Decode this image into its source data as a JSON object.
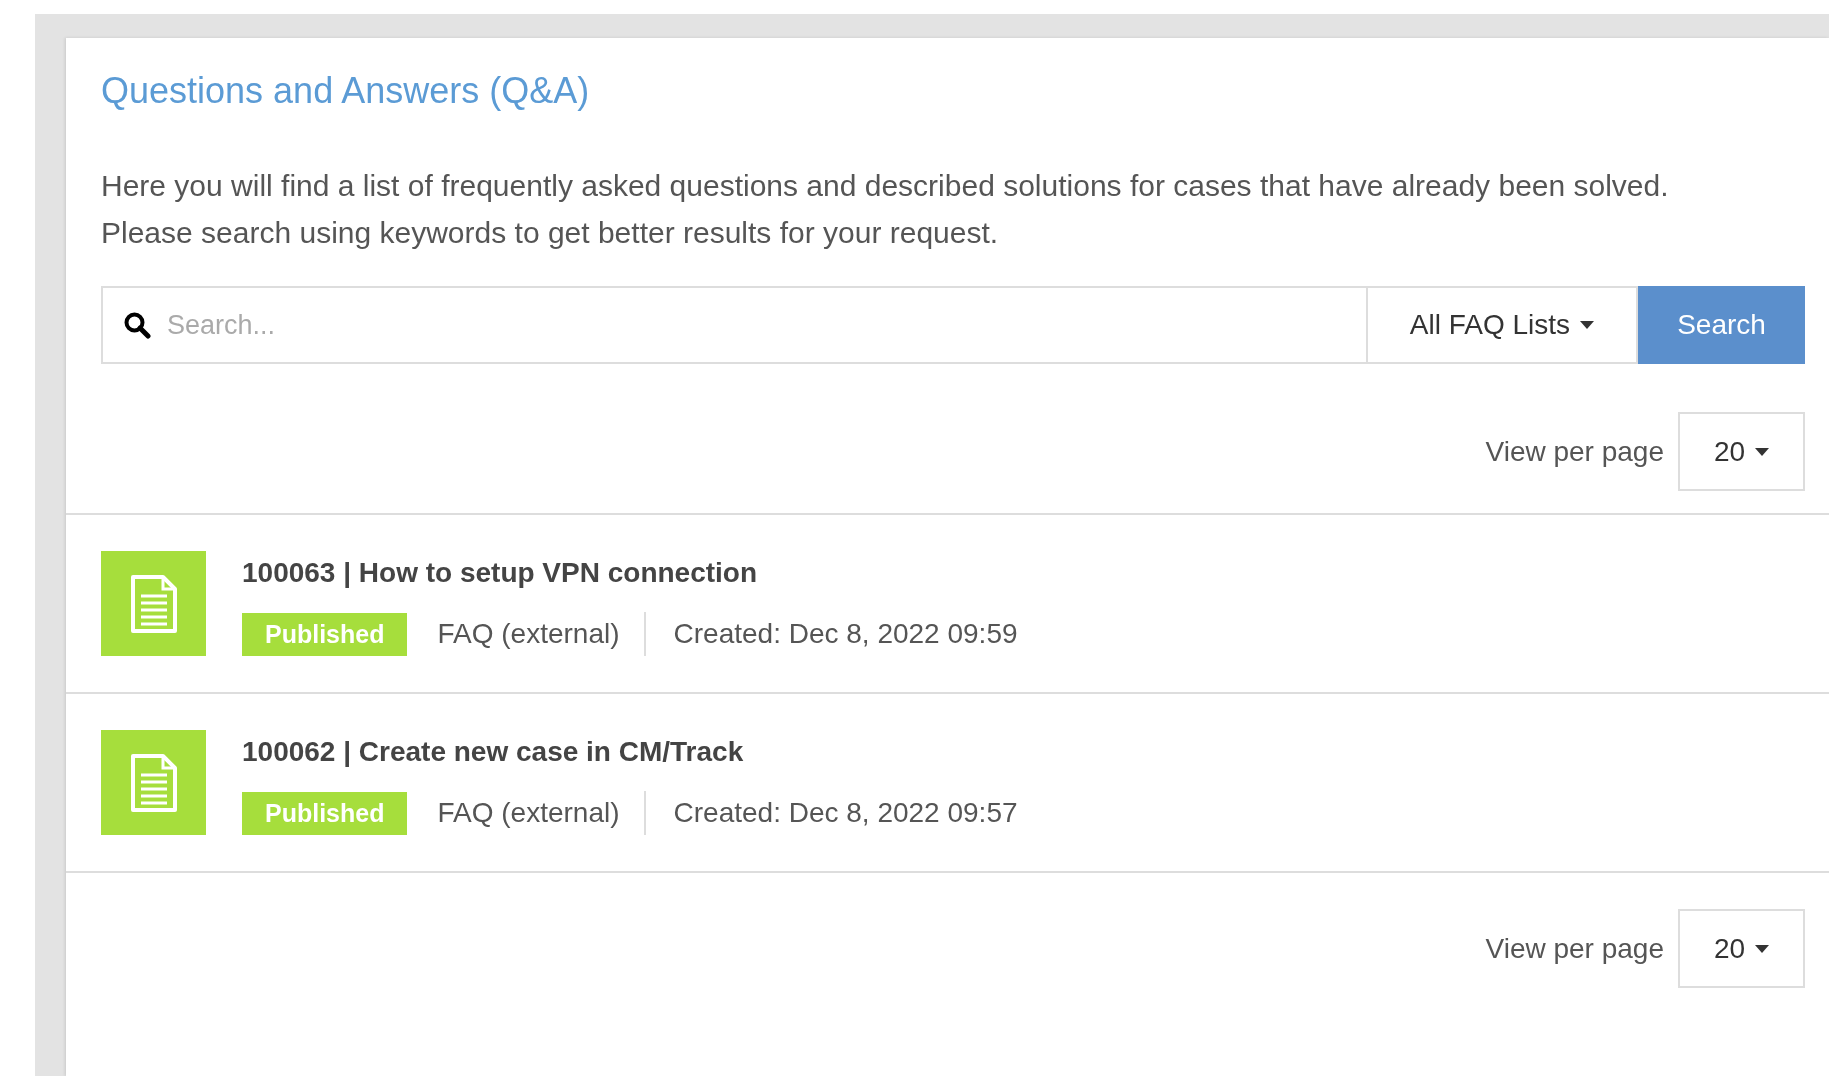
{
  "title": "Questions and Answers (Q&A)",
  "intro": [
    "Here you will find a list of frequently asked questions and described solutions for cases that have already been solved.",
    "Please search using keywords to get better results for your request."
  ],
  "search": {
    "placeholder": "Search...",
    "scope": "All FAQ Lists",
    "button": "Search"
  },
  "pager_top": {
    "label": "View per page",
    "value": "20"
  },
  "entries": [
    {
      "title": "100063 | How to setup VPN connection",
      "status": "Published",
      "list": "FAQ (external)",
      "created": "Created: Dec 8, 2022 09:59"
    },
    {
      "title": "100062 | Create new case in CM/Track",
      "status": "Published",
      "list": "FAQ (external)",
      "created": "Created: Dec 8, 2022 09:57"
    }
  ],
  "pager_bottom": {
    "label": "View per page",
    "value": "20"
  }
}
